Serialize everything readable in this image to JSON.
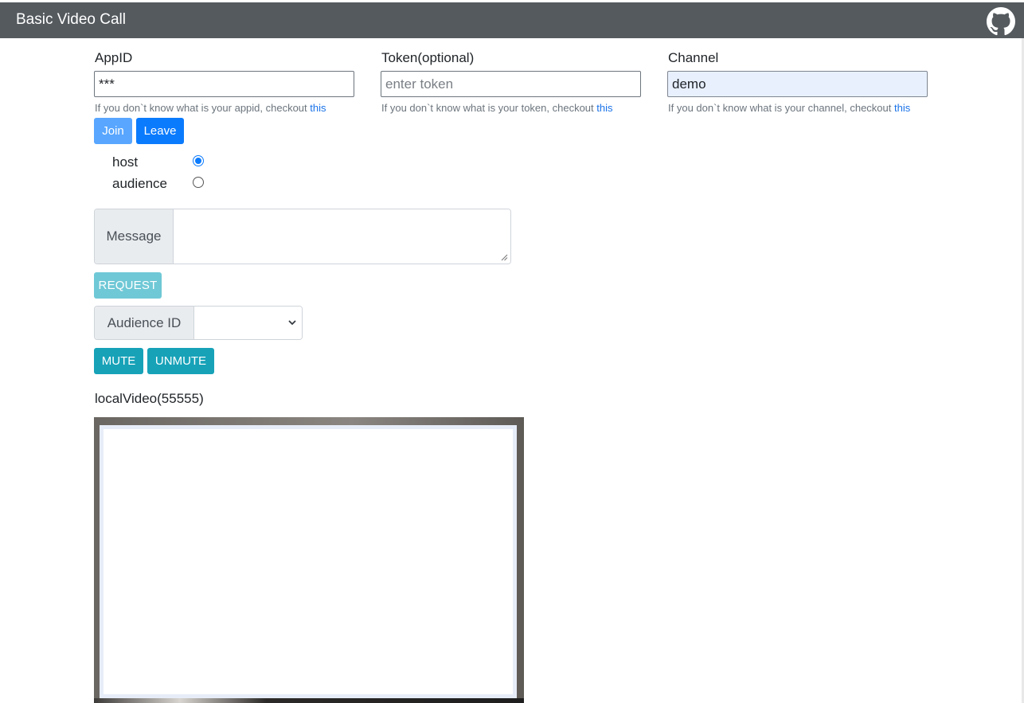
{
  "navbar": {
    "title": "Basic Video Call",
    "github_icon": "github-icon"
  },
  "form": {
    "appid": {
      "label": "AppID",
      "value": "***",
      "help_text": "If you don`t know what is your appid, checkout ",
      "help_link": "this"
    },
    "token": {
      "label": "Token(optional)",
      "placeholder": "enter token",
      "help_text": "If you don`t know what is your token, checkout ",
      "help_link": "this"
    },
    "channel": {
      "label": "Channel",
      "value": "demo",
      "help_text": "If you don`t know what is your channel, checkout ",
      "help_link": "this"
    }
  },
  "buttons": {
    "join": "Join",
    "leave": "Leave",
    "request": "REQUEST",
    "mute": "MUTE",
    "unmute": "UNMUTE"
  },
  "roles": [
    {
      "label": "host",
      "checked": true
    },
    {
      "label": "audience",
      "checked": false
    }
  ],
  "message": {
    "label": "Message",
    "value": ""
  },
  "audience": {
    "label": "Audience ID",
    "selected": ""
  },
  "local_video": {
    "label": "localVideo(55555)"
  },
  "colors": {
    "navbar": "#555a5f",
    "primary": "#0b7bfd",
    "primary_disabled": "#58a6ff",
    "info": "#17a2b8",
    "info_disabled": "#6fc8d6",
    "link": "#1a73e8"
  }
}
